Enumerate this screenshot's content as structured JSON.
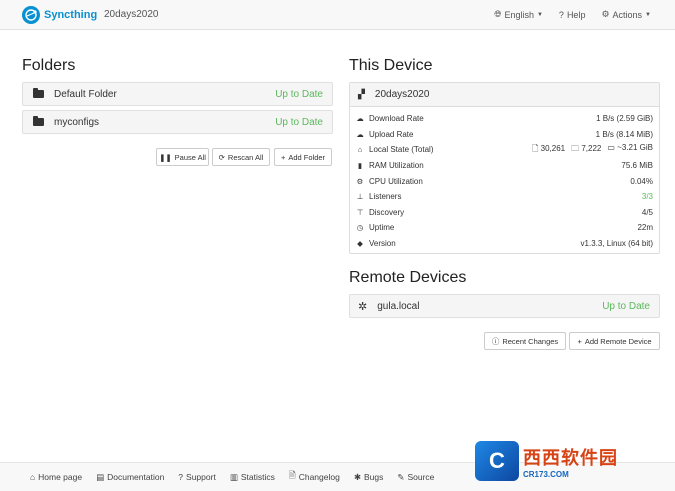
{
  "navbar": {
    "brand": "Syncthing",
    "device_name": "20days2020",
    "language": "English",
    "help": "Help",
    "actions": "Actions"
  },
  "folders": {
    "heading": "Folders",
    "items": [
      {
        "name": "Default Folder",
        "status": "Up to Date"
      },
      {
        "name": "myconfigs",
        "status": "Up to Date"
      }
    ],
    "buttons": {
      "pause_all": "Pause All",
      "rescan_all": "Rescan All",
      "add_folder": "Add Folder"
    }
  },
  "this_device": {
    "heading": "This Device",
    "name": "20days2020",
    "rows": [
      {
        "icon": "cloud-download-icon",
        "label": "Download Rate",
        "value": "1 B/s (2.59 GiB)"
      },
      {
        "icon": "cloud-upload-icon",
        "label": "Upload Rate",
        "value": "1 B/s (8.14 MiB)"
      },
      {
        "icon": "home-icon",
        "label": "Local State (Total)",
        "files": "30,261",
        "dirs": "7,222",
        "size": "~3.21 GiB"
      },
      {
        "icon": "memory-icon",
        "label": "RAM Utilization",
        "value": "75.6 MiB"
      },
      {
        "icon": "cpu-icon",
        "label": "CPU Utilization",
        "value": "0.04%"
      },
      {
        "icon": "sitemap-icon",
        "label": "Listeners",
        "value": "3/3"
      },
      {
        "icon": "signpost-icon",
        "label": "Discovery",
        "value": "4/5"
      },
      {
        "icon": "clock-icon",
        "label": "Uptime",
        "value": "22m"
      },
      {
        "icon": "tag-icon",
        "label": "Version",
        "value": "v1.3.3, Linux (64 bit)"
      }
    ]
  },
  "remote_devices": {
    "heading": "Remote Devices",
    "items": [
      {
        "name": "gula.local",
        "status": "Up to Date"
      }
    ],
    "buttons": {
      "recent_changes": "Recent Changes",
      "add_remote_device": "Add Remote Device"
    }
  },
  "footer": {
    "items": [
      "Home page",
      "Documentation",
      "Support",
      "Statistics",
      "Changelog",
      "Bugs",
      "Source"
    ]
  },
  "watermark": {
    "main": "西西软件园",
    "sub": "CR173.COM"
  },
  "colors": {
    "brand": "#0891d1",
    "status_ok": "#5cb85c"
  }
}
